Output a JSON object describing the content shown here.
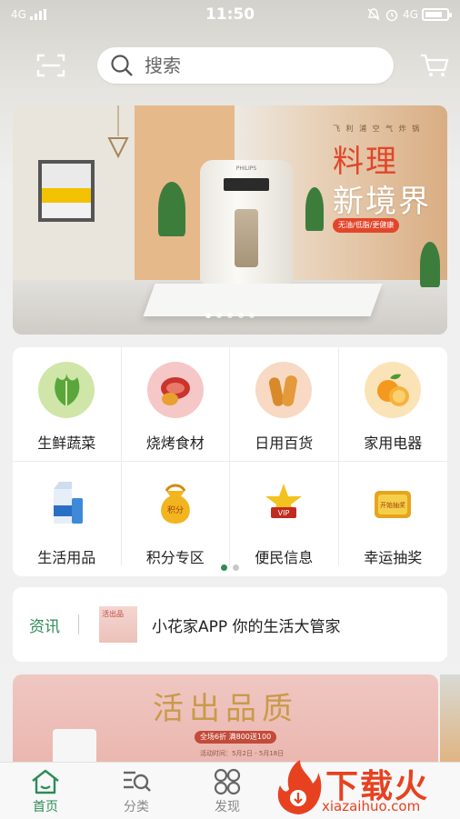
{
  "status_bar": {
    "network_left": "4G",
    "time": "11:50",
    "network_right": "4G"
  },
  "search": {
    "placeholder": "搜索"
  },
  "banner": {
    "tagline": "飞 利 浦 空 气 炸 锅",
    "title_line1": "料理",
    "title_line2": "新境界",
    "pill": "无油/低脂/更健康",
    "brand": "PHILIPS",
    "slide_count": 5,
    "active_slide": 1
  },
  "categories": [
    {
      "label": "生鲜蔬菜",
      "icon": "vegetable-icon"
    },
    {
      "label": "烧烤食材",
      "icon": "meat-icon"
    },
    {
      "label": "日用百货",
      "icon": "bread-icon"
    },
    {
      "label": "家用电器",
      "icon": "orange-icon"
    },
    {
      "label": "生活用品",
      "icon": "milk-icon"
    },
    {
      "label": "积分专区",
      "icon": "money-bag-icon",
      "icon_text": "积分"
    },
    {
      "label": "便民信息",
      "icon": "vip-star-icon",
      "icon_text": "VIP"
    },
    {
      "label": "幸运抽奖",
      "icon": "lottery-icon",
      "icon_text": "开始抽奖"
    }
  ],
  "category_pages": {
    "count": 2,
    "active": 1
  },
  "news": {
    "label": "资讯",
    "thumb_text": "活出品",
    "text": "小花家APP 你的生活大管家"
  },
  "promo": {
    "title": "活出品质",
    "sub": "全场6折 满800送100",
    "date": "活动时间：5月2日 - 5月18日"
  },
  "tabs": [
    {
      "label": "首页",
      "icon": "home-icon",
      "active": true
    },
    {
      "label": "分类",
      "icon": "category-icon",
      "active": false
    },
    {
      "label": "发现",
      "icon": "discover-icon",
      "active": false
    }
  ],
  "watermark": {
    "text": "下载火",
    "url": "xiazaihuo.com"
  },
  "colors": {
    "accent": "#2e8b57",
    "banner_red": "#e2462a",
    "watermark": "#e8411f"
  }
}
